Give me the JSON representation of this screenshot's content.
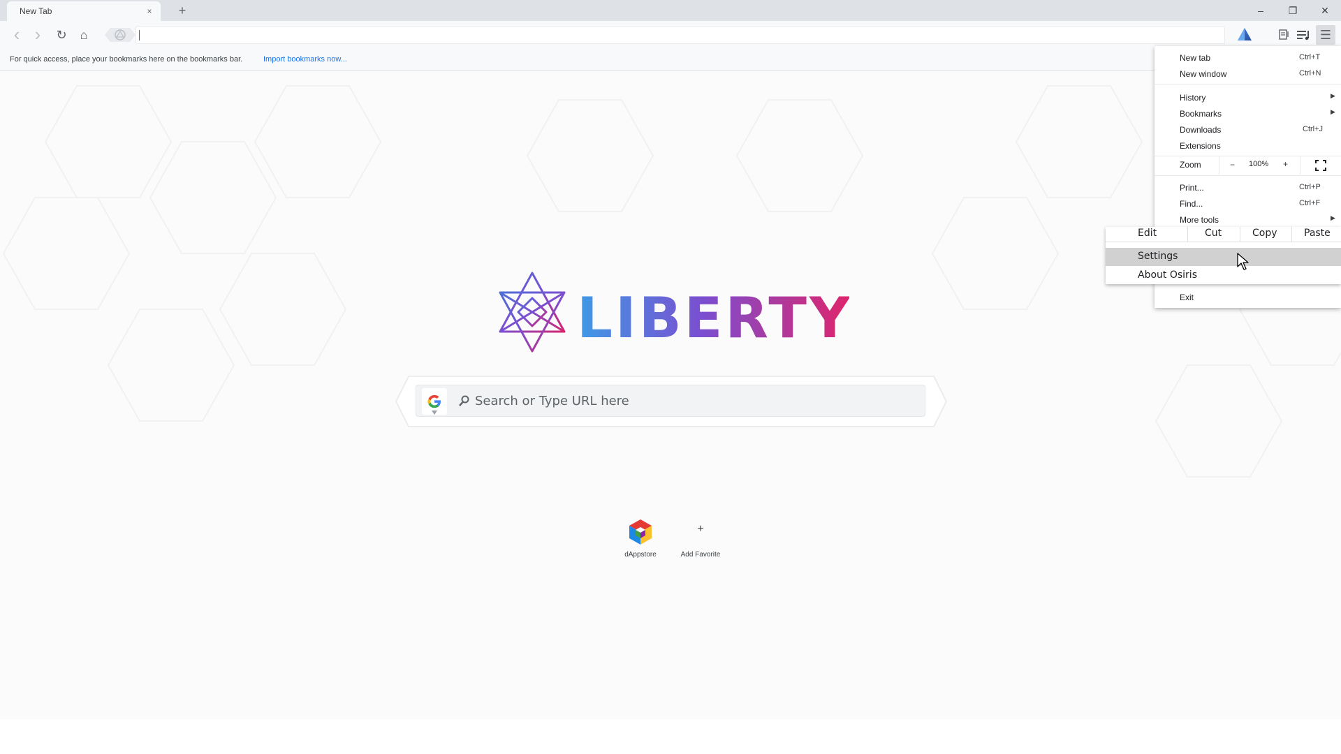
{
  "tab": {
    "title": "New Tab",
    "close_glyph": "×",
    "new_tab_glyph": "+"
  },
  "window_controls": {
    "minimize": "–",
    "restore": "❐",
    "close": "✕"
  },
  "toolbar": {
    "back_glyph": "‹",
    "forward_glyph": "›",
    "reload_glyph": "↻",
    "home_glyph": "⌂",
    "menu_glyph": "☰",
    "omnibox_value": ""
  },
  "bookmarks_bar": {
    "message": "For quick access, place your bookmarks here on the bookmarks bar.",
    "import_link": "Import bookmarks now..."
  },
  "search": {
    "placeholder": "Search or Type URL here",
    "engine_icon": "google-g-icon"
  },
  "favorites": [
    {
      "label": "dAppstore",
      "icon": "dappstore-cube-icon"
    },
    {
      "label": "Add Favorite",
      "icon": "plus-icon",
      "glyph": "+"
    }
  ],
  "menu": {
    "new_tab": {
      "label": "New tab",
      "shortcut": "Ctrl+T"
    },
    "new_window": {
      "label": "New window",
      "shortcut": "Ctrl+N"
    },
    "history": {
      "label": "History"
    },
    "bookmarks": {
      "label": "Bookmarks"
    },
    "downloads": {
      "label": "Downloads",
      "shortcut": "Ctrl+J"
    },
    "extensions": {
      "label": "Extensions"
    },
    "zoom": {
      "label": "Zoom",
      "minus": "−",
      "value": "100%",
      "plus": "+"
    },
    "print": {
      "label": "Print...",
      "shortcut": "Ctrl+P"
    },
    "find": {
      "label": "Find...",
      "shortcut": "Ctrl+F"
    },
    "more_tools": {
      "label": "More tools"
    },
    "edit": {
      "label": "Edit",
      "cut": "Cut",
      "copy": "Copy",
      "paste": "Paste"
    },
    "settings": {
      "label": "Settings"
    },
    "about": {
      "label": "About Osiris"
    },
    "exit": {
      "label": "Exit"
    },
    "arrow_glyph": "▶"
  },
  "colors": {
    "accent_link": "#1a73e8",
    "menu_highlight": "#d1d1d1",
    "logo_gradient": [
      "#3f86e0",
      "#7a4fd1",
      "#d6246e"
    ]
  }
}
